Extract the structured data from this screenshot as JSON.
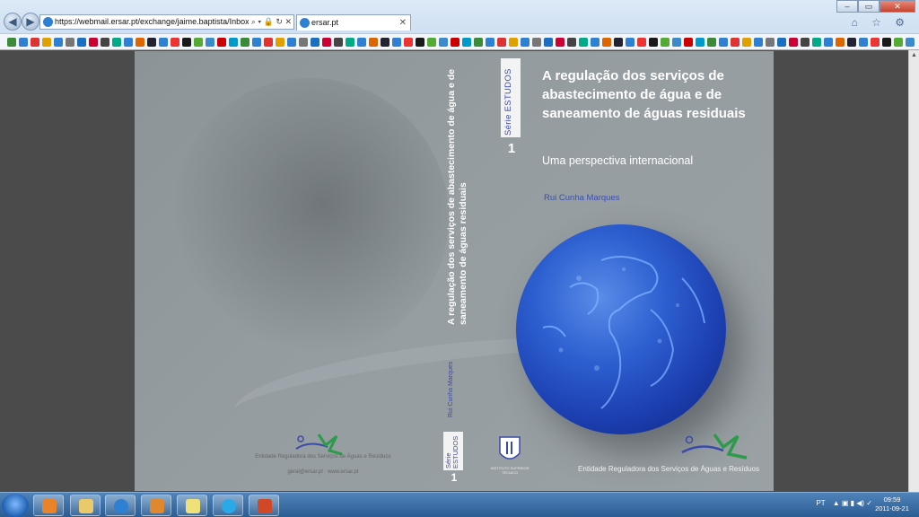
{
  "browser": {
    "address_url": "https://webmail.ersar.pt/exchange/jaime.baptista/Inbox/Capa",
    "address_tools": "⌕ ▾ 🔒 ↻ ✕",
    "tab_title": "ersar.pt",
    "tab_close": "✕",
    "window_controls": [
      "–",
      "▭",
      "✕"
    ],
    "right_toolbar": "⌂ ☆ ⚙"
  },
  "cover": {
    "title": "A regulação dos serviços de abastecimento de água e de saneamento de águas residuais",
    "subtitle": "Uma perspectiva internacional",
    "author": "Rui Cunha Marques",
    "series_label": "Série ESTUDOS",
    "series_number": "1",
    "spine_title": "A regulação dos serviços de abastecimento de água e de saneamento de águas residuais",
    "spine_author": "Rui Cunha Marques",
    "front_institution": "Entidade Reguladora dos Serviços de Águas e Resíduos",
    "back_institution": "Entidade Reguladora dos Serviços de Águas e Resíduos",
    "back_contact": "geral@ersar.pt  ·  www.ersar.pt",
    "ist_label": "INSTITUTO SUPERIOR TÉCNICO"
  },
  "taskbar": {
    "language": "PT",
    "tray_icons": "▲ ▣ ▮ ◀) ✓",
    "time": "09:59",
    "date": "2011-09-21"
  },
  "colors": {
    "author_blue": "#3b4fb0",
    "cover_grey": "#959da1",
    "globe_blue": "#2d5fd0"
  }
}
